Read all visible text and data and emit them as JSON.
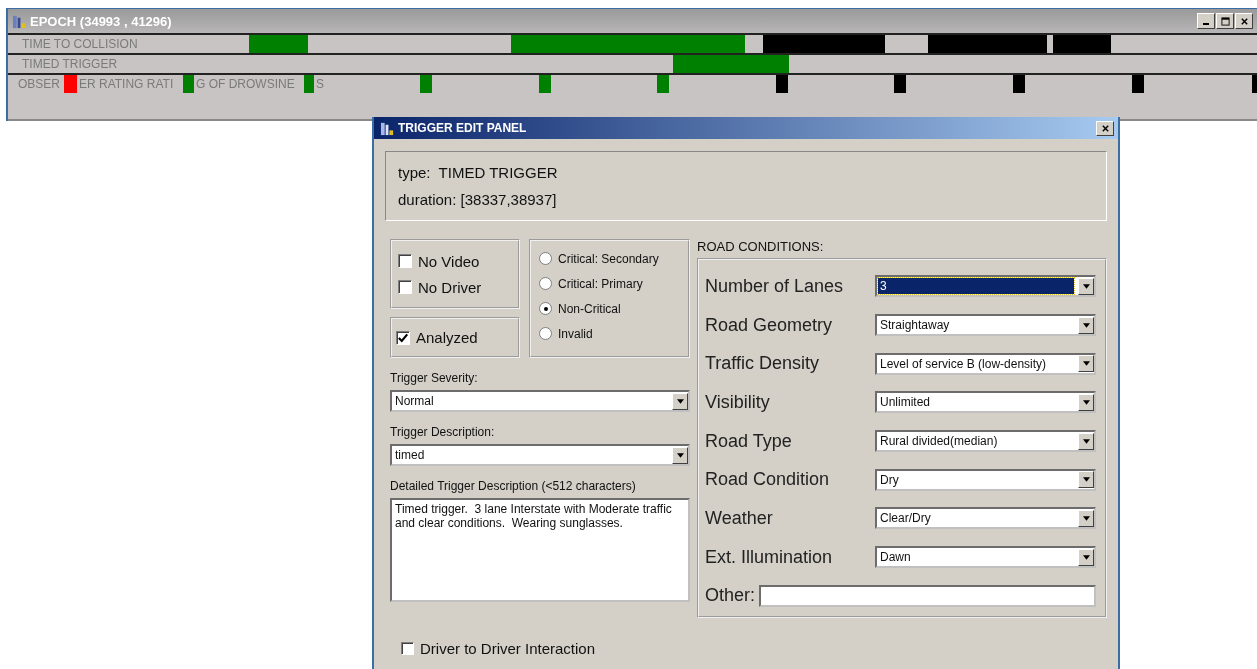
{
  "epoch_window": {
    "title": "EPOCH (34993 , 41296)",
    "tracks": [
      {
        "labels": [
          "TIME TO COLLISION"
        ],
        "segments": [
          {
            "color": "#008000"
          },
          {
            "color": "#008000"
          },
          {
            "color": "#000000"
          },
          {
            "color": "#000000"
          },
          {
            "color": "#000000"
          }
        ]
      },
      {
        "labels": [
          "TIMED TRIGGER"
        ],
        "segments": [
          {
            "color": "#008000"
          }
        ]
      },
      {
        "labels": [
          "OBSER",
          "ER RATING RATI",
          "G OF DROWSINE",
          "S"
        ],
        "segments": [
          {
            "color": "#ff0000"
          },
          {
            "color": "#008000"
          },
          {
            "color": "#008000"
          },
          {
            "color": "#008000"
          },
          {
            "color": "#008000"
          },
          {
            "color": "#008000"
          },
          {
            "color": "#000000"
          },
          {
            "color": "#000000"
          },
          {
            "color": "#000000"
          },
          {
            "color": "#000000"
          },
          {
            "color": "#000000"
          }
        ]
      }
    ]
  },
  "dialog": {
    "title": "TRIGGER EDIT PANEL",
    "info": [
      "type:  TIMED TRIGGER",
      "duration: [38337,38937]"
    ],
    "flags": [
      {
        "label": "No Video",
        "checked": false
      },
      {
        "label": "No Driver",
        "checked": false
      }
    ],
    "analyzed": {
      "label": "Analyzed",
      "checked": true
    },
    "criticality": [
      {
        "label": "Critical: Secondary",
        "selected": false
      },
      {
        "label": "Critical: Primary",
        "selected": false
      },
      {
        "label": "Non-Critical",
        "selected": true
      },
      {
        "label": "Invalid",
        "selected": false
      }
    ],
    "severity": {
      "label": "Trigger Severity:",
      "value": "Normal"
    },
    "description": {
      "label": "Trigger Description:",
      "value": "timed"
    },
    "detail": {
      "label": "Detailed Trigger Description (<512 characters)",
      "value": "Timed trigger.  3 lane Interstate with Moderate traffic and clear conditions.  Wearing sunglasses."
    },
    "interaction": {
      "label": "Driver to Driver Interaction",
      "checked": false
    },
    "road_conditions": {
      "title": "ROAD CONDITIONS:",
      "fields": [
        {
          "label": "Number of Lanes",
          "value": "3",
          "focused": true
        },
        {
          "label": "Road Geometry",
          "value": "Straightaway",
          "focused": false
        },
        {
          "label": "Traffic Density",
          "value": "Level of service B (low-density)",
          "focused": false
        },
        {
          "label": "Visibility",
          "value": "Unlimited",
          "focused": false
        },
        {
          "label": "Road Type",
          "value": "Rural divided(median)",
          "focused": false
        },
        {
          "label": "Road Condition",
          "value": "Dry",
          "focused": false
        },
        {
          "label": "Weather",
          "value": "Clear/Dry",
          "focused": false
        },
        {
          "label": "Ext. Illumination",
          "value": "Dawn",
          "focused": false
        }
      ],
      "other": {
        "label": "Other:"
      }
    }
  }
}
